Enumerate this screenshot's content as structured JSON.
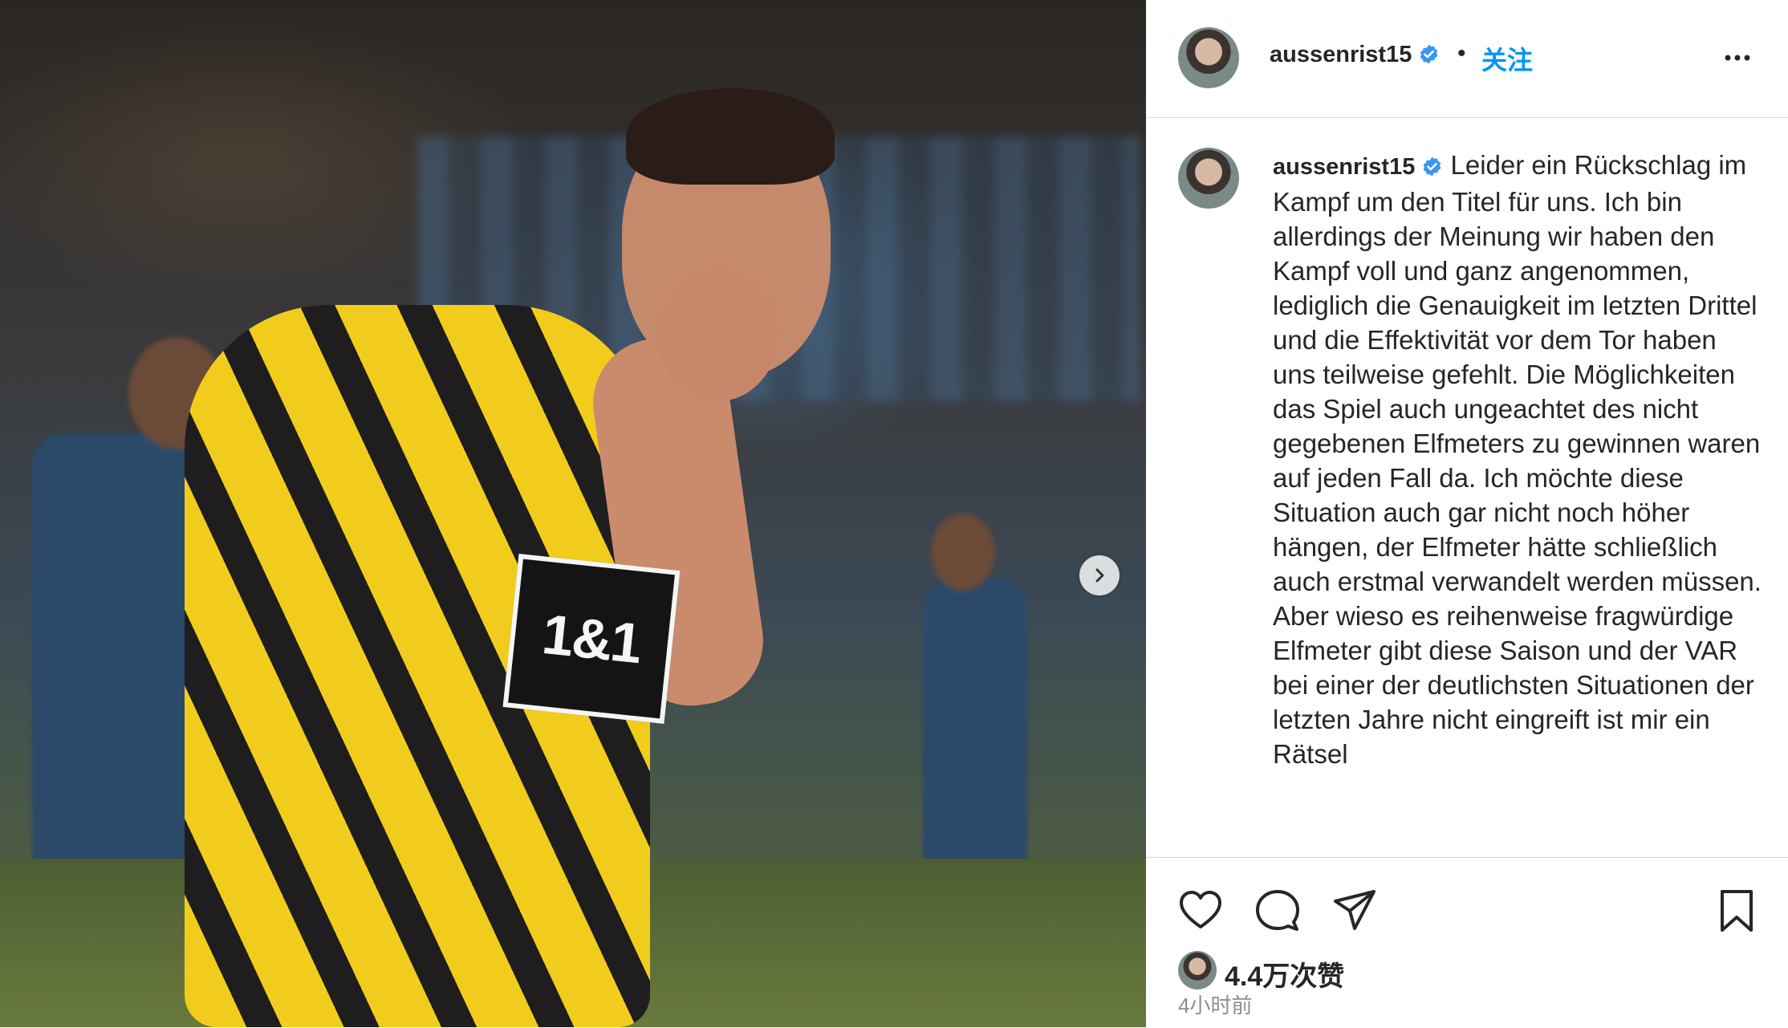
{
  "post": {
    "username": "aussenrist15",
    "follow_label": "关注",
    "separator": "•",
    "caption": "Leider ein Rückschlag im Kampf um den Titel für uns. Ich bin allerdings der Meinung wir haben den Kampf voll und ganz angenommen, lediglich die Genauigkeit im letzten Drittel und die Effektivität vor dem Tor haben uns teilweise gefehlt. Die Möglichkeiten das Spiel auch ungeachtet des nicht gegebenen Elfmeters zu gewinnen waren auf jeden Fall da. Ich möchte diese Situation auch gar nicht noch höher hängen, der Elfmeter hätte schließlich auch erstmal verwandelt werden müssen. Aber wieso es reihenweise fragwürdige Elfmeter gibt diese Saison und der VAR bei einer der deutlichsten Situationen der letzten Jahre nicht eingreift ist mir ein Rätsel",
    "likes": "4.4万次赞",
    "timestamp": "4小时前"
  },
  "media": {
    "sponsor_text": "1&1"
  },
  "icons": {
    "verified": "verified-badge-icon",
    "more": "more-options-icon",
    "like": "heart-icon",
    "comment": "comment-icon",
    "share": "share-icon",
    "save": "bookmark-icon",
    "next": "chevron-right-icon"
  },
  "colors": {
    "accent": "#0095f6",
    "text": "#262626",
    "muted": "#8e8e8e",
    "divider": "#dbdbdb"
  }
}
